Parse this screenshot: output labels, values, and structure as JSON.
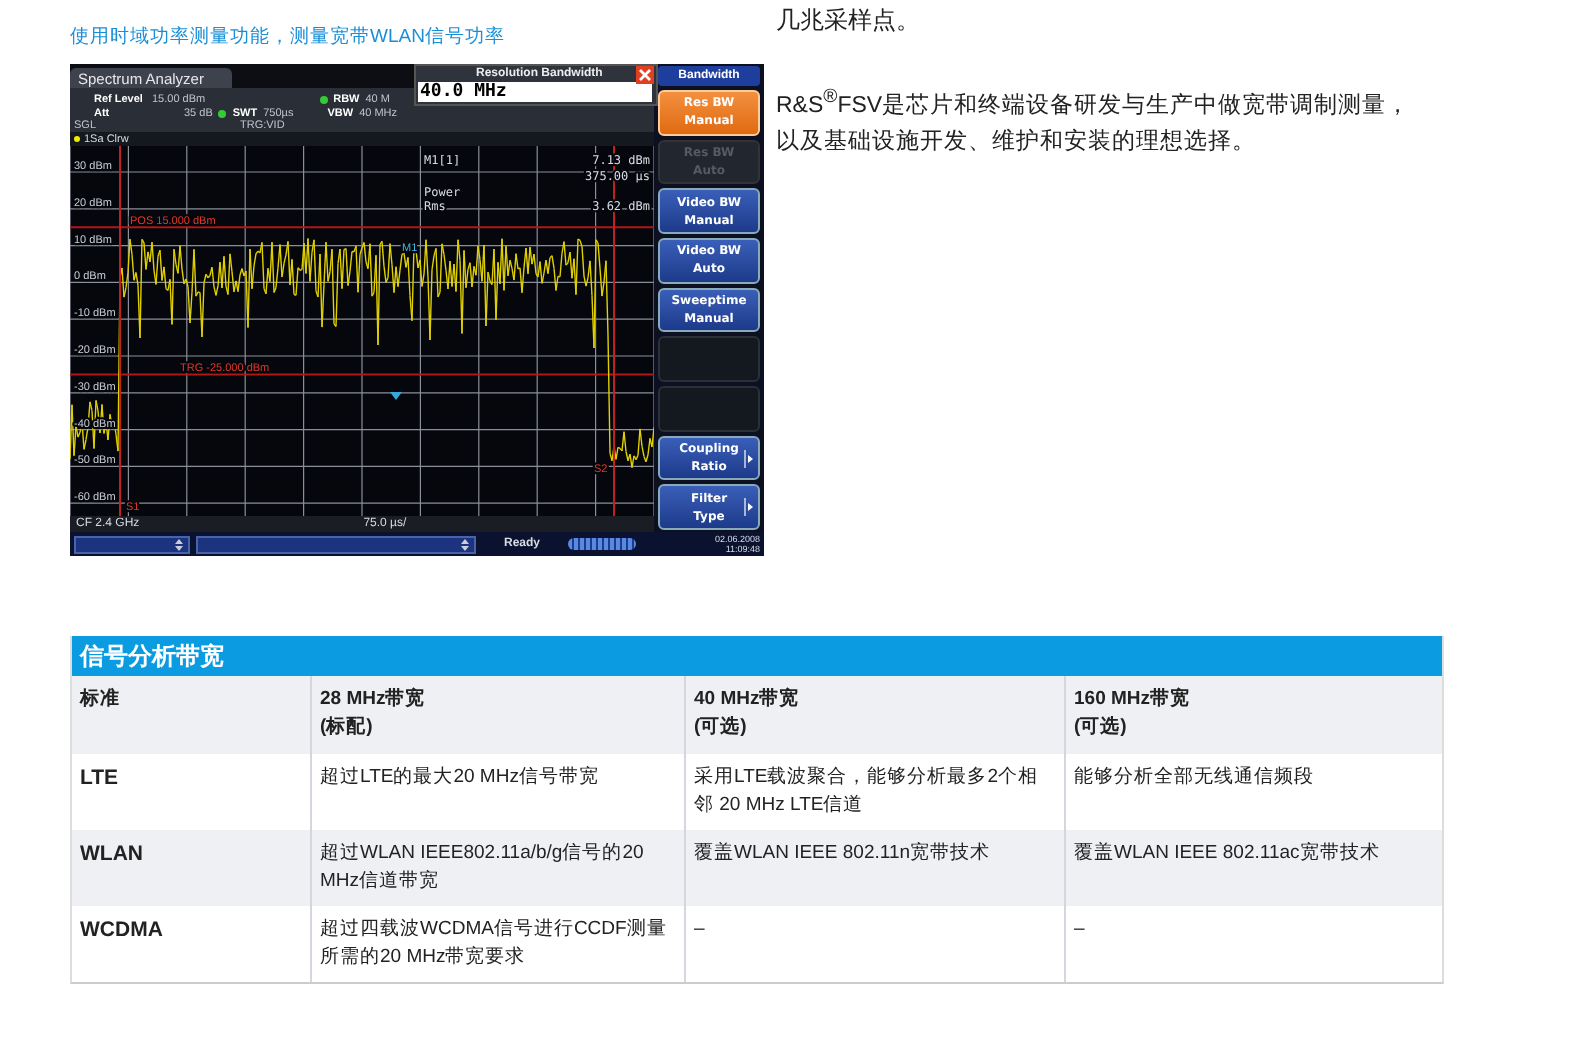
{
  "caption": "使用时域功率测量功能，测量宽带WLAN信号功率",
  "analyzer": {
    "title": "Spectrum Analyzer",
    "dialog": {
      "title": "Resolution Bandwidth",
      "value": "40.0 MHz"
    },
    "settings": [
      {
        "label": "Ref Level",
        "value": "15.00 dBm"
      },
      {
        "label": "RBW",
        "value": "40 M"
      },
      {
        "label": "Att",
        "value": "35 dB"
      },
      {
        "label": "SWT",
        "value": "750µs"
      },
      {
        "label": "VBW",
        "value": "40 MHz"
      }
    ],
    "mode": "SGL",
    "trigger": "TRG:VID",
    "trace": "1Sa Clrw",
    "marker_label": "M1[1]",
    "marker_level": "7.13 dBm",
    "marker_time": "375.00 µs",
    "power_label": "Power",
    "power_mode": "Rms",
    "power_value": "3.62 dBm",
    "y_labels": [
      "30 dBm",
      "20 dBm",
      "10 dBm",
      "0 dBm",
      "-10 dBm",
      "-20 dBm",
      "-30 dBm",
      "-40 dBm",
      "-50 dBm",
      "-60 dBm"
    ],
    "lines": [
      {
        "label": "POS 15.000 dBm"
      },
      {
        "label": "TRG -25.000 dBm"
      }
    ],
    "marker_tag": "M1",
    "sweep_start": "S1",
    "sweep_end": "S2",
    "center_freq": "CF 2.4 GHz",
    "scale": "75.0 µs/",
    "status": "Ready",
    "date": "02.06.2008",
    "time": "11:09:48",
    "softkey_title": "Bandwidth",
    "softkeys": [
      {
        "kind": "key",
        "lines": [
          "Res BW",
          "Manual"
        ],
        "selected": true,
        "disabled": false,
        "submenu": false
      },
      {
        "kind": "key",
        "lines": [
          "Res BW",
          "Auto"
        ],
        "selected": false,
        "disabled": true,
        "submenu": false
      },
      {
        "kind": "key",
        "lines": [
          "Video BW",
          "Manual"
        ],
        "selected": false,
        "disabled": false,
        "submenu": false
      },
      {
        "kind": "key",
        "lines": [
          "Video BW",
          "Auto"
        ],
        "selected": false,
        "disabled": false,
        "submenu": false
      },
      {
        "kind": "key",
        "lines": [
          "Sweeptime",
          "Manual"
        ],
        "selected": false,
        "disabled": false,
        "submenu": false
      },
      {
        "kind": "empty"
      },
      {
        "kind": "empty"
      },
      {
        "kind": "key",
        "lines": [
          "Coupling",
          "Ratio"
        ],
        "selected": false,
        "disabled": false,
        "submenu": true
      },
      {
        "kind": "key",
        "lines": [
          "Filter",
          "Type"
        ],
        "selected": false,
        "disabled": false,
        "submenu": true
      }
    ]
  },
  "intro_tail": "几兆采样点。",
  "paragraph": [
    "R&S$^{®}$FSV是芯片和终端设备研发与生产中做宽带调制测量，",
    "以及基础设施开发、维护和安装的理想选择。"
  ],
  "table": {
    "title": "信号分析带宽",
    "columns": [
      {
        "label": "标准"
      },
      {
        "label": "28 MHz带宽",
        "note": "(标配)"
      },
      {
        "label": "40 MHz带宽",
        "note": "(可选)"
      },
      {
        "label": "160 MHz带宽",
        "note": "(可选)"
      }
    ],
    "rows": [
      {
        "cells": [
          "LTE",
          "超过LTE的最大20 MHz信号带宽",
          "采用LTE载波聚合，能够分析最多2个相邻 20 MHz LTE信道",
          "能够分析全部无线通信频段"
        ]
      },
      {
        "cells": [
          "WLAN",
          "超过WLAN IEEE802.11a/b/g信号的20 MHz信道带宽",
          "覆盖WLAN IEEE 802.11n宽带技术",
          "覆盖WLAN IEEE 802.11ac宽带技术"
        ]
      },
      {
        "cells": [
          "WCDMA",
          "超过四载波WCDMA信号进行CCDF测量所需的20 MHz带宽要求",
          "–",
          "–"
        ]
      }
    ]
  }
}
